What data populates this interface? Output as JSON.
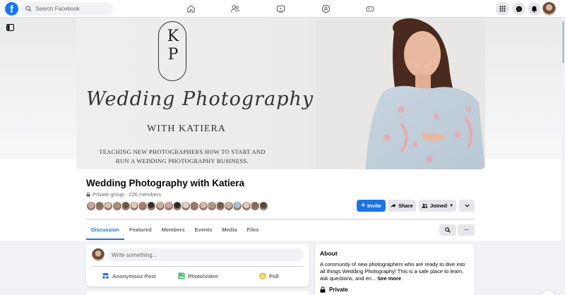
{
  "topbar": {
    "logo": "f",
    "search_placeholder": "Search Facebook",
    "nav_icons": [
      "home-icon",
      "friends-icon",
      "watch-icon",
      "groups-icon",
      "gaming-icon"
    ],
    "right_icons": [
      "menu-grid-icon",
      "messenger-icon",
      "bell-icon"
    ]
  },
  "cover": {
    "monogram": "K\nP",
    "script_title": "Wedding Photography",
    "with_line": "WITH KATIERA",
    "tagline": "TEACHING NEW PHOTOGRAPHERS HOW TO START AND RUN A WEDDING PHOTOGRAPHY BUSINESS."
  },
  "group": {
    "name": "Wedding Photography with Katiera",
    "meta": "Private group · 226 members",
    "member_colors": [
      "#c9a892",
      "#8a6f5e",
      "#d8c0b0",
      "#b08c78",
      "#6e5242",
      "#e0c8b8",
      "#a57f66",
      "#3b2f2a",
      "#c7b39f",
      "#d9a09a",
      "#2a2a2a",
      "#e6d2c0",
      "#9c7a66",
      "#d4b8a6",
      "#b59680",
      "#7a5c4a",
      "#cbb3a3",
      "#a9c3d6",
      "#e2ccbd",
      "#8b6a58",
      "#5a4236"
    ]
  },
  "actions": {
    "invite": "Invite",
    "share": "Share",
    "joined": "Joined"
  },
  "tabs": [
    "Discussion",
    "Featured",
    "Members",
    "Events",
    "Media",
    "Files"
  ],
  "composer": {
    "placeholder": "Write something...",
    "anon": "Anonymous Post",
    "photo": "Photo/video",
    "poll": "Poll"
  },
  "about": {
    "title": "About",
    "text": "A community of new photographers who are ready to dive into all things Wedding Photography! This is a safe place to learn, ask questions, and en...",
    "see_more": "See more",
    "privacy": "Private"
  },
  "colors": {
    "accent": "#1b74e4",
    "bg": "#f0f2f5"
  }
}
